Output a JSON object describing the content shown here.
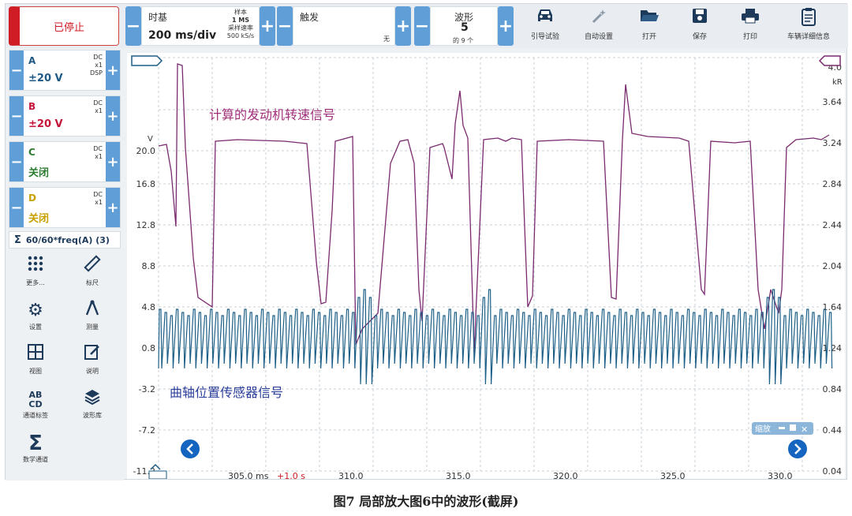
{
  "toolbar": {
    "stop_label": "已停止",
    "timebase_label": "时基",
    "timebase_value": "200 ms/div",
    "samples_label": "样本",
    "samples_value": "1 MS",
    "rate_label": "采样速率",
    "rate_value": "500 kS/s",
    "trigger_label": "触发",
    "trigger_mode": "无",
    "waveform_label": "波形",
    "waveform_value": "5",
    "waveform_total": "的 9 个",
    "minus": "−",
    "plus": "+",
    "tools": [
      {
        "label": "引导试验",
        "icon": "car-icon"
      },
      {
        "label": "自动设置",
        "icon": "wand-icon"
      },
      {
        "label": "打开",
        "icon": "folder-icon"
      },
      {
        "label": "保存",
        "icon": "save-icon"
      },
      {
        "label": "打印",
        "icon": "print-icon"
      },
      {
        "label": "车辆详细信息",
        "icon": "clipboard-icon"
      }
    ]
  },
  "channels": [
    {
      "name": "A",
      "range": "±20 V",
      "coupling": "DC",
      "probe": "x1",
      "extra": "DSP",
      "color": "#1f5a86"
    },
    {
      "name": "B",
      "range": "±20 V",
      "coupling": "DC",
      "probe": "x1",
      "extra": "",
      "color": "#c4163a"
    },
    {
      "name": "C",
      "range": "关闭",
      "coupling": "DC",
      "probe": "x1",
      "extra": "",
      "color": "#2e7d32"
    },
    {
      "name": "D",
      "range": "关闭",
      "coupling": "DC",
      "probe": "x1",
      "extra": "",
      "color": "#c8a000"
    }
  ],
  "math_channel": "60/60*freq(A) (3)",
  "left_tools": [
    {
      "label": "更多...",
      "icon": "more-icon"
    },
    {
      "label": "标尺",
      "icon": "ruler-icon"
    },
    {
      "label": "设置",
      "icon": "gear-icon"
    },
    {
      "label": "测量",
      "icon": "compass-icon"
    },
    {
      "label": "视图",
      "icon": "grid-icon"
    },
    {
      "label": "说明",
      "icon": "note-icon"
    },
    {
      "label": "通道标签",
      "icon": "abcd-icon"
    },
    {
      "label": "波形库",
      "icon": "library-icon"
    },
    {
      "label": "数学通道",
      "icon": "sigma-icon"
    }
  ],
  "scope": {
    "left_unit": "V",
    "left_ticks": [
      "20.0",
      "16.8",
      "12.8",
      "8.8",
      "4.8",
      "0.8",
      "-3.2",
      "-7.2",
      "-11.2"
    ],
    "right_unit": "kR",
    "right_ticks": [
      "4.0",
      "3.64",
      "3.24",
      "2.84",
      "2.44",
      "2.04",
      "1.64",
      "1.24",
      "0.84",
      "0.44",
      "0.04"
    ],
    "x_ticks": [
      "305.0 ms",
      "310.0",
      "315.0",
      "320.0",
      "325.0",
      "330.0"
    ],
    "x_offset": "+1.0 s",
    "rpm_label": "计算的发动机转速信号",
    "crank_label": "曲轴位置传感器信号",
    "zoom_label": "缩放",
    "zoom_close": "✕",
    "colors": {
      "rpm": "#7a2a6e",
      "crank": "#1d5f86",
      "rpm_text": "#a0307a",
      "crank_text": "#2a3e9a",
      "grid": "#c8d0d6",
      "nav": "#1565c0"
    }
  },
  "caption": "图7   局部放大图6中的波形(截屏)"
}
